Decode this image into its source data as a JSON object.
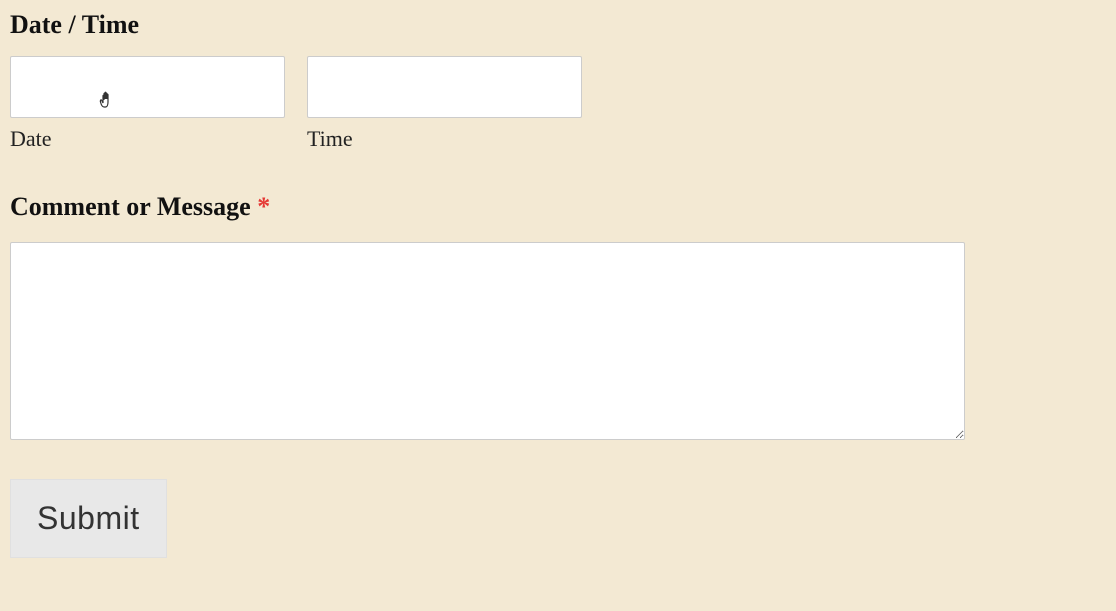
{
  "form": {
    "datetime_heading": "Date / Time",
    "date_label": "Date",
    "time_label": "Time",
    "date_value": "",
    "time_value": "",
    "comment_heading": "Comment or Message ",
    "required_mark": "*",
    "comment_value": "",
    "submit_label": "Submit"
  }
}
